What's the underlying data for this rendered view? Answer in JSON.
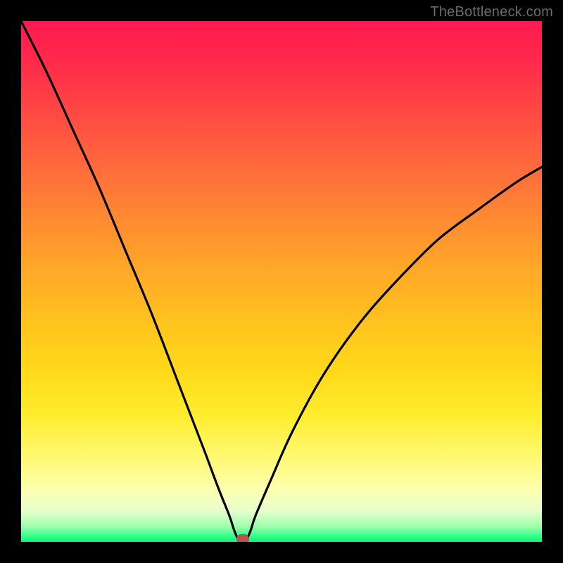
{
  "watermark": "TheBottleneck.com",
  "colors": {
    "frame": "#000000",
    "watermark": "#6b6b6b",
    "curve": "#000000",
    "marker": "#b4554f"
  },
  "chart_data": {
    "type": "line",
    "title": "",
    "xlabel": "",
    "ylabel": "",
    "xlim": [
      0,
      100
    ],
    "ylim": [
      0,
      100
    ],
    "grid": false,
    "legend": false,
    "series": [
      {
        "name": "bottleneck-curve",
        "x": [
          0,
          5,
          10,
          15,
          20,
          25,
          30,
          35,
          38,
          40,
          41,
          42,
          43,
          44,
          45,
          48,
          52,
          58,
          65,
          72,
          80,
          88,
          95,
          100
        ],
        "y": [
          100,
          90,
          79,
          68,
          56,
          44,
          31,
          18,
          10,
          5,
          2,
          0,
          0,
          2,
          5,
          12,
          21,
          32,
          42,
          50,
          58,
          64,
          69,
          72
        ]
      }
    ],
    "marker": {
      "x": 42.5,
      "y": 0
    },
    "background_gradient": {
      "top": "#ff1a4e",
      "mid": "#ffdb1a",
      "bottom": "#11f07a"
    }
  }
}
